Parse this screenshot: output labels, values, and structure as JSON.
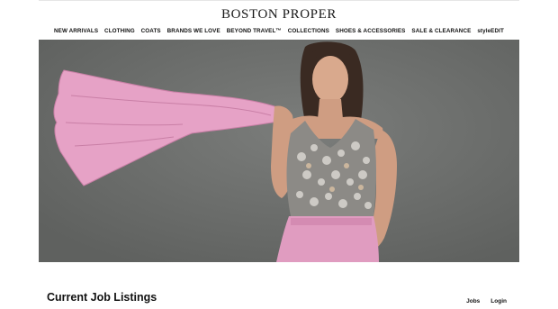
{
  "brand": {
    "name": "BOSTON PROPER"
  },
  "nav": {
    "items": [
      {
        "label": "NEW ARRIVALS"
      },
      {
        "label": "CLOTHING"
      },
      {
        "label": "COATS"
      },
      {
        "label": "BRANDS WE LOVE"
      },
      {
        "label": "BEYOND TRAVEL™"
      },
      {
        "label": "COLLECTIONS"
      },
      {
        "label": "SHOES & ACCESSORIES"
      },
      {
        "label": "SALE & CLEARANCE"
      },
      {
        "label": "styleEDIT"
      }
    ]
  },
  "hero": {
    "background_color": "#6d6f6d",
    "accent_color": "#e6a2c6"
  },
  "footer": {
    "title": "Current Job Listings",
    "links": {
      "jobs": "Jobs",
      "login": "Login"
    }
  }
}
